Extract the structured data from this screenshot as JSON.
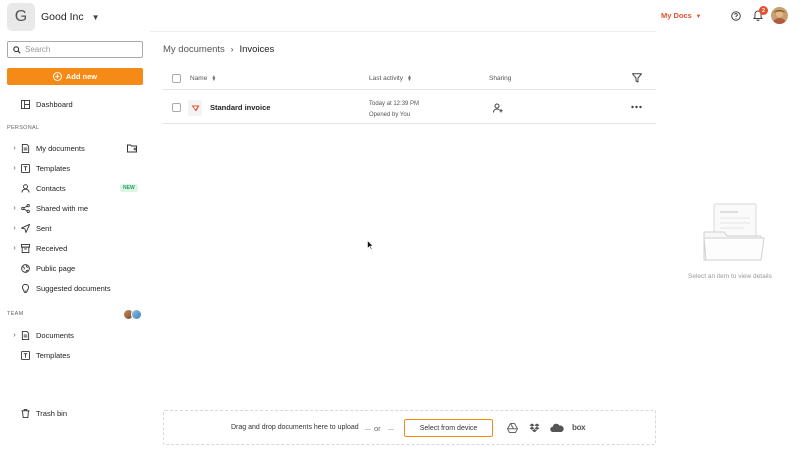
{
  "org": {
    "initial": "G",
    "name": "Good Inc"
  },
  "search": {
    "placeholder": "Search"
  },
  "add_new": {
    "label": "Add new"
  },
  "sidebar": {
    "dashboard": "Dashboard",
    "personal_label": "PERSONAL",
    "personal": [
      {
        "label": "My documents",
        "icon": "document-icon"
      },
      {
        "label": "Templates",
        "icon": "template-icon"
      },
      {
        "label": "Contacts",
        "icon": "contacts-icon",
        "badge": "NEW"
      },
      {
        "label": "Shared with me",
        "icon": "share-icon"
      },
      {
        "label": "Sent",
        "icon": "send-icon"
      },
      {
        "label": "Received",
        "icon": "inbox-icon"
      },
      {
        "label": "Public page",
        "icon": "globe-icon"
      },
      {
        "label": "Suggested documents",
        "icon": "lightbulb-icon"
      }
    ],
    "team_label": "TEAM",
    "team": [
      {
        "label": "Documents",
        "icon": "document-icon"
      },
      {
        "label": "Templates",
        "icon": "template-icon"
      }
    ],
    "trash": "Trash bin"
  },
  "header": {
    "workspace_switch": "My Docs",
    "notification_count": "2"
  },
  "breadcrumb": {
    "parent": "My documents",
    "current": "Invoices"
  },
  "table": {
    "columns": {
      "name": "Name",
      "activity": "Last activity",
      "sharing": "Sharing"
    },
    "rows": [
      {
        "name": "Standard invoice",
        "activity_time": "Today at 12:39 PM",
        "activity_desc": "Opened by You"
      }
    ]
  },
  "panel": {
    "empty_text": "Select an item to view details"
  },
  "upload": {
    "drag_text": "Drag and drop documents here to upload",
    "or": "or",
    "select_button": "Select from device",
    "providers": [
      "google-drive-icon",
      "dropbox-icon",
      "onedrive-icon",
      "box-icon"
    ],
    "box_label": "box"
  },
  "colors": {
    "accent": "#f58a16",
    "brand_red": "#e5502f"
  }
}
